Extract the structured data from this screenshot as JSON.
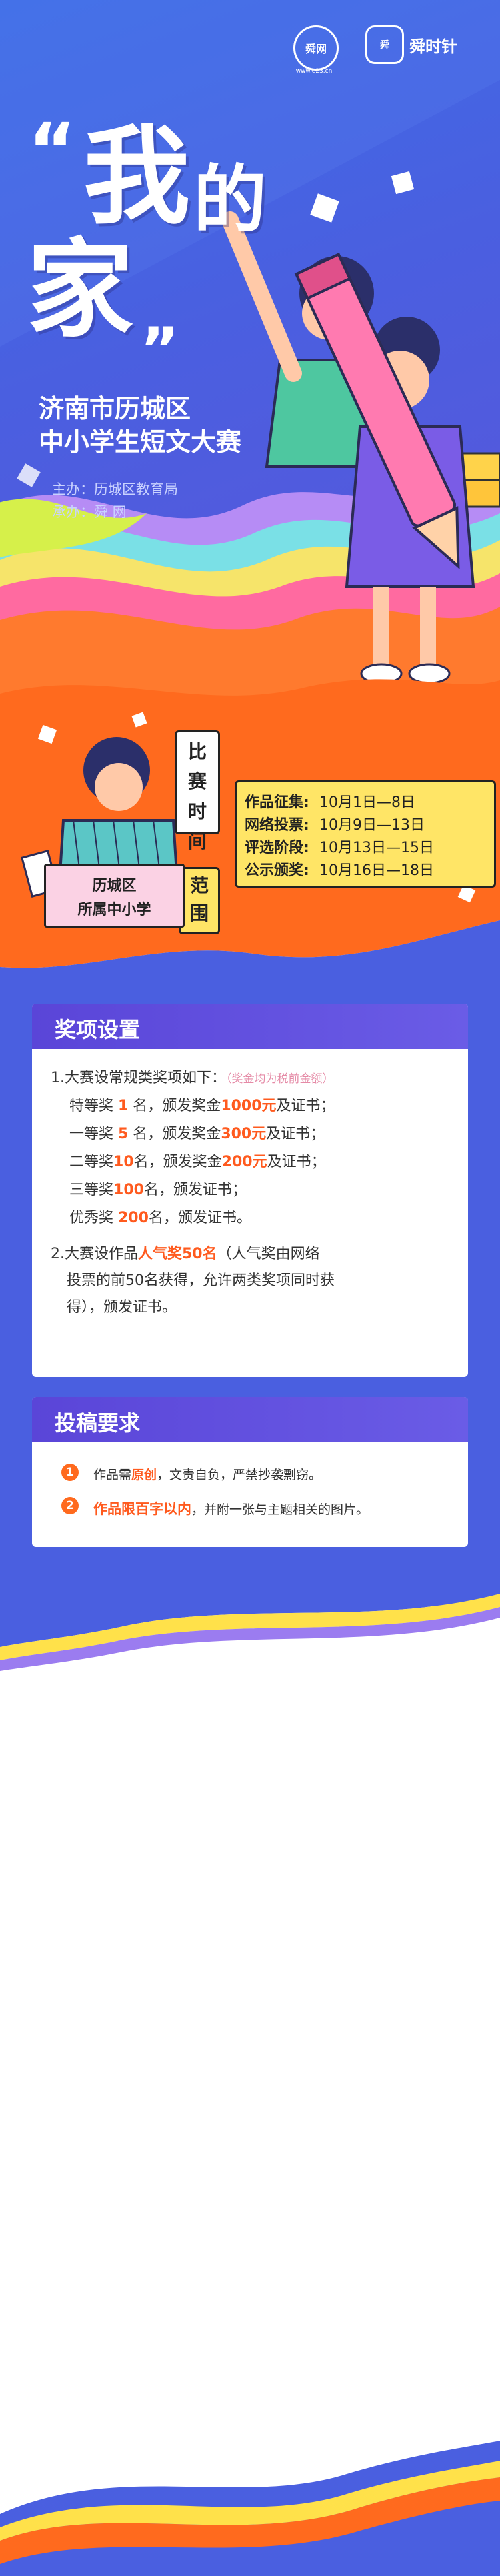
{
  "header": {
    "logo_left_text": "舜网",
    "logo_left_sub": "www.e23.cn",
    "logo_right_seal": "舜",
    "logo_right_name": "舜时针"
  },
  "title": {
    "open_quote": "“",
    "char1": "我",
    "char2": "的",
    "char3": "家",
    "close_quote": "”",
    "sub_line1": "济南市历城区",
    "sub_line2": "中小学生短文大赛",
    "host": "主办：历城区教育局",
    "organizer": "承办：舜 网"
  },
  "schedule": {
    "side_label": "比赛时间",
    "rows": [
      {
        "label": "作品征集:",
        "value": "10月1日—8日"
      },
      {
        "label": "网络投票:",
        "value": "10月9日—13日"
      },
      {
        "label": "评选阶段:",
        "value": "10月13日—15日"
      },
      {
        "label": "公示颁奖:",
        "value": "10月16日—18日"
      }
    ]
  },
  "scope": {
    "side_label": "范围",
    "line1": "历城区",
    "line2": "所属中小学"
  },
  "awards": {
    "heading": "奖项设置",
    "intro": "1.大赛设常规类奖项如下：",
    "intro_note": "（奖金均为税前金额）",
    "items": [
      {
        "pre": "特等奖 ",
        "count": "1",
        "mid": " 名，颁发奖金",
        "prize": "1000元",
        "post": "及证书；"
      },
      {
        "pre": "一等奖 ",
        "count": "5",
        "mid": " 名，颁发奖金",
        "prize": "300元",
        "post": "及证书；"
      },
      {
        "pre": "二等奖",
        "count": "10",
        "mid": "名，颁发奖金",
        "prize": "200元",
        "post": "及证书；"
      },
      {
        "pre": "三等奖",
        "count": "100",
        "mid": "名，颁发证书；",
        "prize": "",
        "post": ""
      },
      {
        "pre": "优秀奖 ",
        "count": "200",
        "mid": "名，颁发证书。",
        "prize": "",
        "post": ""
      }
    ],
    "popular_pre": "2.大赛设作品",
    "popular_hl": "人气奖50名",
    "popular_post": "（人气奖由网络",
    "popular_line2": "投票的前50名获得，允许两类奖项同时获",
    "popular_line3": "得），颁发证书。"
  },
  "requirements": {
    "heading": "投稿要求",
    "items": [
      {
        "num": "1",
        "pre": "作品需",
        "hl": "原创",
        "post": "，文责自负，严禁抄袭剽窃。"
      },
      {
        "num": "2",
        "pre": "",
        "hl": "作品限百字以内",
        "post": "，并附一张与主题相关的图片。"
      }
    ]
  },
  "colors": {
    "hero_blue": "#4a5fe0",
    "accent_orange": "#ff6a1e",
    "highlight_yellow": "#ffe566",
    "card_header_purple": "#5a45d8"
  }
}
